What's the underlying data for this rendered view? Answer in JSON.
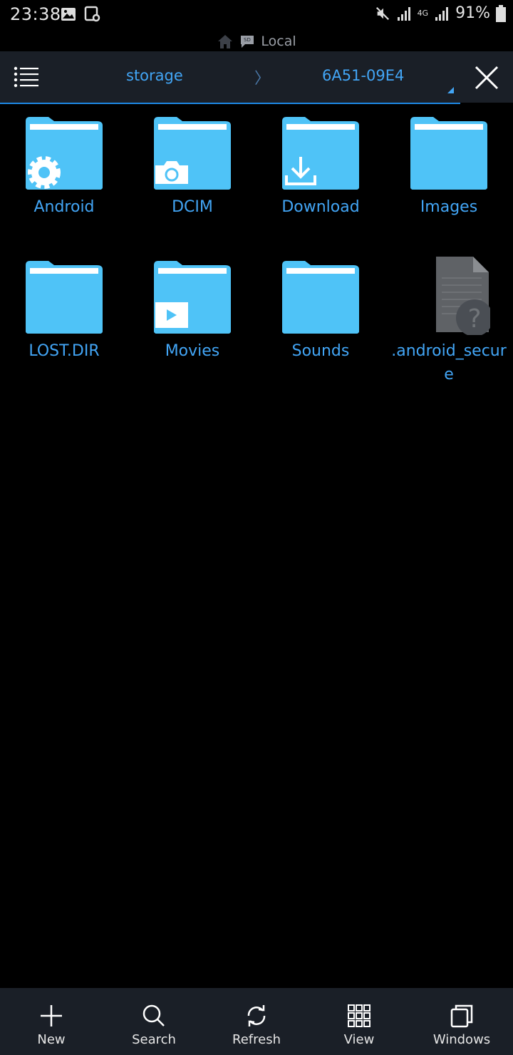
{
  "status_bar": {
    "time": "23:38",
    "network": "4G",
    "battery": "91%"
  },
  "location": {
    "label": "Local"
  },
  "toolbar": {
    "breadcrumb_storage": "storage",
    "breadcrumb_separator": "〉",
    "breadcrumb_device": "6A51-09E4"
  },
  "files": [
    {
      "name": "Android",
      "icon": "folder-settings-icon"
    },
    {
      "name": "DCIM",
      "icon": "folder-camera-icon"
    },
    {
      "name": "Download",
      "icon": "folder-download-icon"
    },
    {
      "name": "Images",
      "icon": "folder-icon"
    },
    {
      "name": "LOST.DIR",
      "icon": "folder-icon"
    },
    {
      "name": "Movies",
      "icon": "folder-video-icon"
    },
    {
      "name": "Sounds",
      "icon": "folder-icon"
    },
    {
      "name": ".android_secure",
      "icon": "unknown-file-icon"
    }
  ],
  "bottom_bar": {
    "new": "New",
    "search": "Search",
    "refresh": "Refresh",
    "view": "View",
    "windows": "Windows"
  },
  "colors": {
    "accent": "#42a5f5",
    "folder": "#4fc3f7",
    "toolbar_bg": "#1a1f27"
  }
}
